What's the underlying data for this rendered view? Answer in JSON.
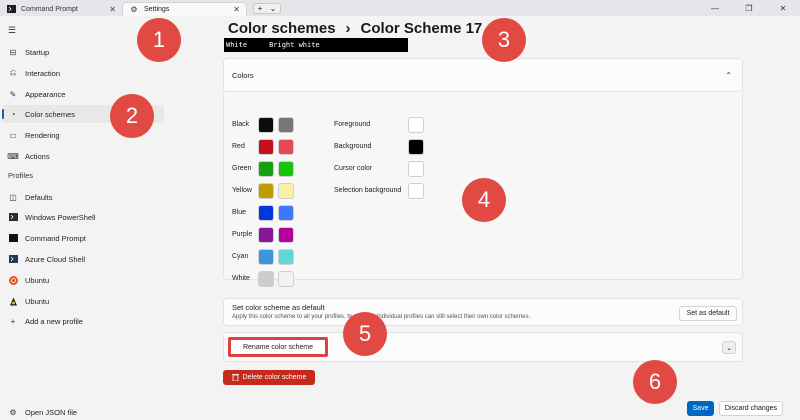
{
  "tabs": [
    {
      "label": "Command Prompt",
      "icon": "terminal-icon"
    },
    {
      "label": "Settings",
      "icon": "gear-icon"
    }
  ],
  "newtab": {
    "plus": "+",
    "dropdown": "⌄"
  },
  "window": {
    "minimize": "—",
    "maximize": "❐",
    "close": "✕"
  },
  "sidebar": {
    "items": [
      {
        "label": "Startup",
        "icon": "startup-icon"
      },
      {
        "label": "Interaction",
        "icon": "interaction-icon"
      },
      {
        "label": "Appearance",
        "icon": "brush-icon"
      },
      {
        "label": "Color schemes",
        "icon": "palette-icon"
      },
      {
        "label": "Rendering",
        "icon": "monitor-icon"
      },
      {
        "label": "Actions",
        "icon": "keyboard-icon"
      }
    ],
    "profiles_header": "Profiles",
    "profiles": [
      {
        "label": "Defaults",
        "icon": "layers-icon"
      },
      {
        "label": "Windows PowerShell",
        "icon": "powershell-icon"
      },
      {
        "label": "Command Prompt",
        "icon": "cmd-icon"
      },
      {
        "label": "Azure Cloud Shell",
        "icon": "azure-icon"
      },
      {
        "label": "Ubuntu",
        "icon": "ubuntu-icon"
      },
      {
        "label": "Ubuntu",
        "icon": "linux-icon"
      },
      {
        "label": "Add a new profile",
        "icon": "plus-icon"
      }
    ],
    "json": "Open JSON file"
  },
  "breadcrumb": {
    "parent": "Color schemes",
    "sep": "›",
    "current": "Color Scheme 17"
  },
  "preview": {
    "left": "White",
    "right": "Bright white"
  },
  "colors_section": {
    "title": "Colors",
    "rows": [
      {
        "label": "Black",
        "normal": "#0c0c0c",
        "bright": "#767676"
      },
      {
        "label": "Red",
        "normal": "#c50f1f",
        "bright": "#e74856"
      },
      {
        "label": "Green",
        "normal": "#13a10e",
        "bright": "#16c60c"
      },
      {
        "label": "Yellow",
        "normal": "#c19c00",
        "bright": "#f9f1a5"
      },
      {
        "label": "Blue",
        "normal": "#0037da",
        "bright": "#3b78ff"
      },
      {
        "label": "Purple",
        "normal": "#881798",
        "bright": "#b4009e"
      },
      {
        "label": "Cyan",
        "normal": "#3a96dd",
        "bright": "#61d6d6"
      },
      {
        "label": "White",
        "normal": "#cccccc",
        "bright": "#f2f2f2"
      }
    ],
    "other": [
      {
        "label": "Foreground",
        "color": "#ffffff"
      },
      {
        "label": "Background",
        "color": "#000000"
      },
      {
        "label": "Cursor color",
        "color": "#ffffff"
      },
      {
        "label": "Selection background",
        "color": "#ffffff"
      }
    ]
  },
  "default_card": {
    "title": "Set color scheme as default",
    "desc": "Apply this color scheme to all your profiles, by default. Individual profiles can still select their own color schemes.",
    "button": "Set as default"
  },
  "rename": {
    "label": "Rename color scheme",
    "chevron": "⌄"
  },
  "delete": {
    "label": "Delete color scheme"
  },
  "footer": {
    "save": "Save",
    "discard": "Discard changes"
  },
  "callouts": [
    "1",
    "2",
    "3",
    "4",
    "5",
    "6"
  ],
  "accent": "#0067c0",
  "danger": "#c42b1c"
}
